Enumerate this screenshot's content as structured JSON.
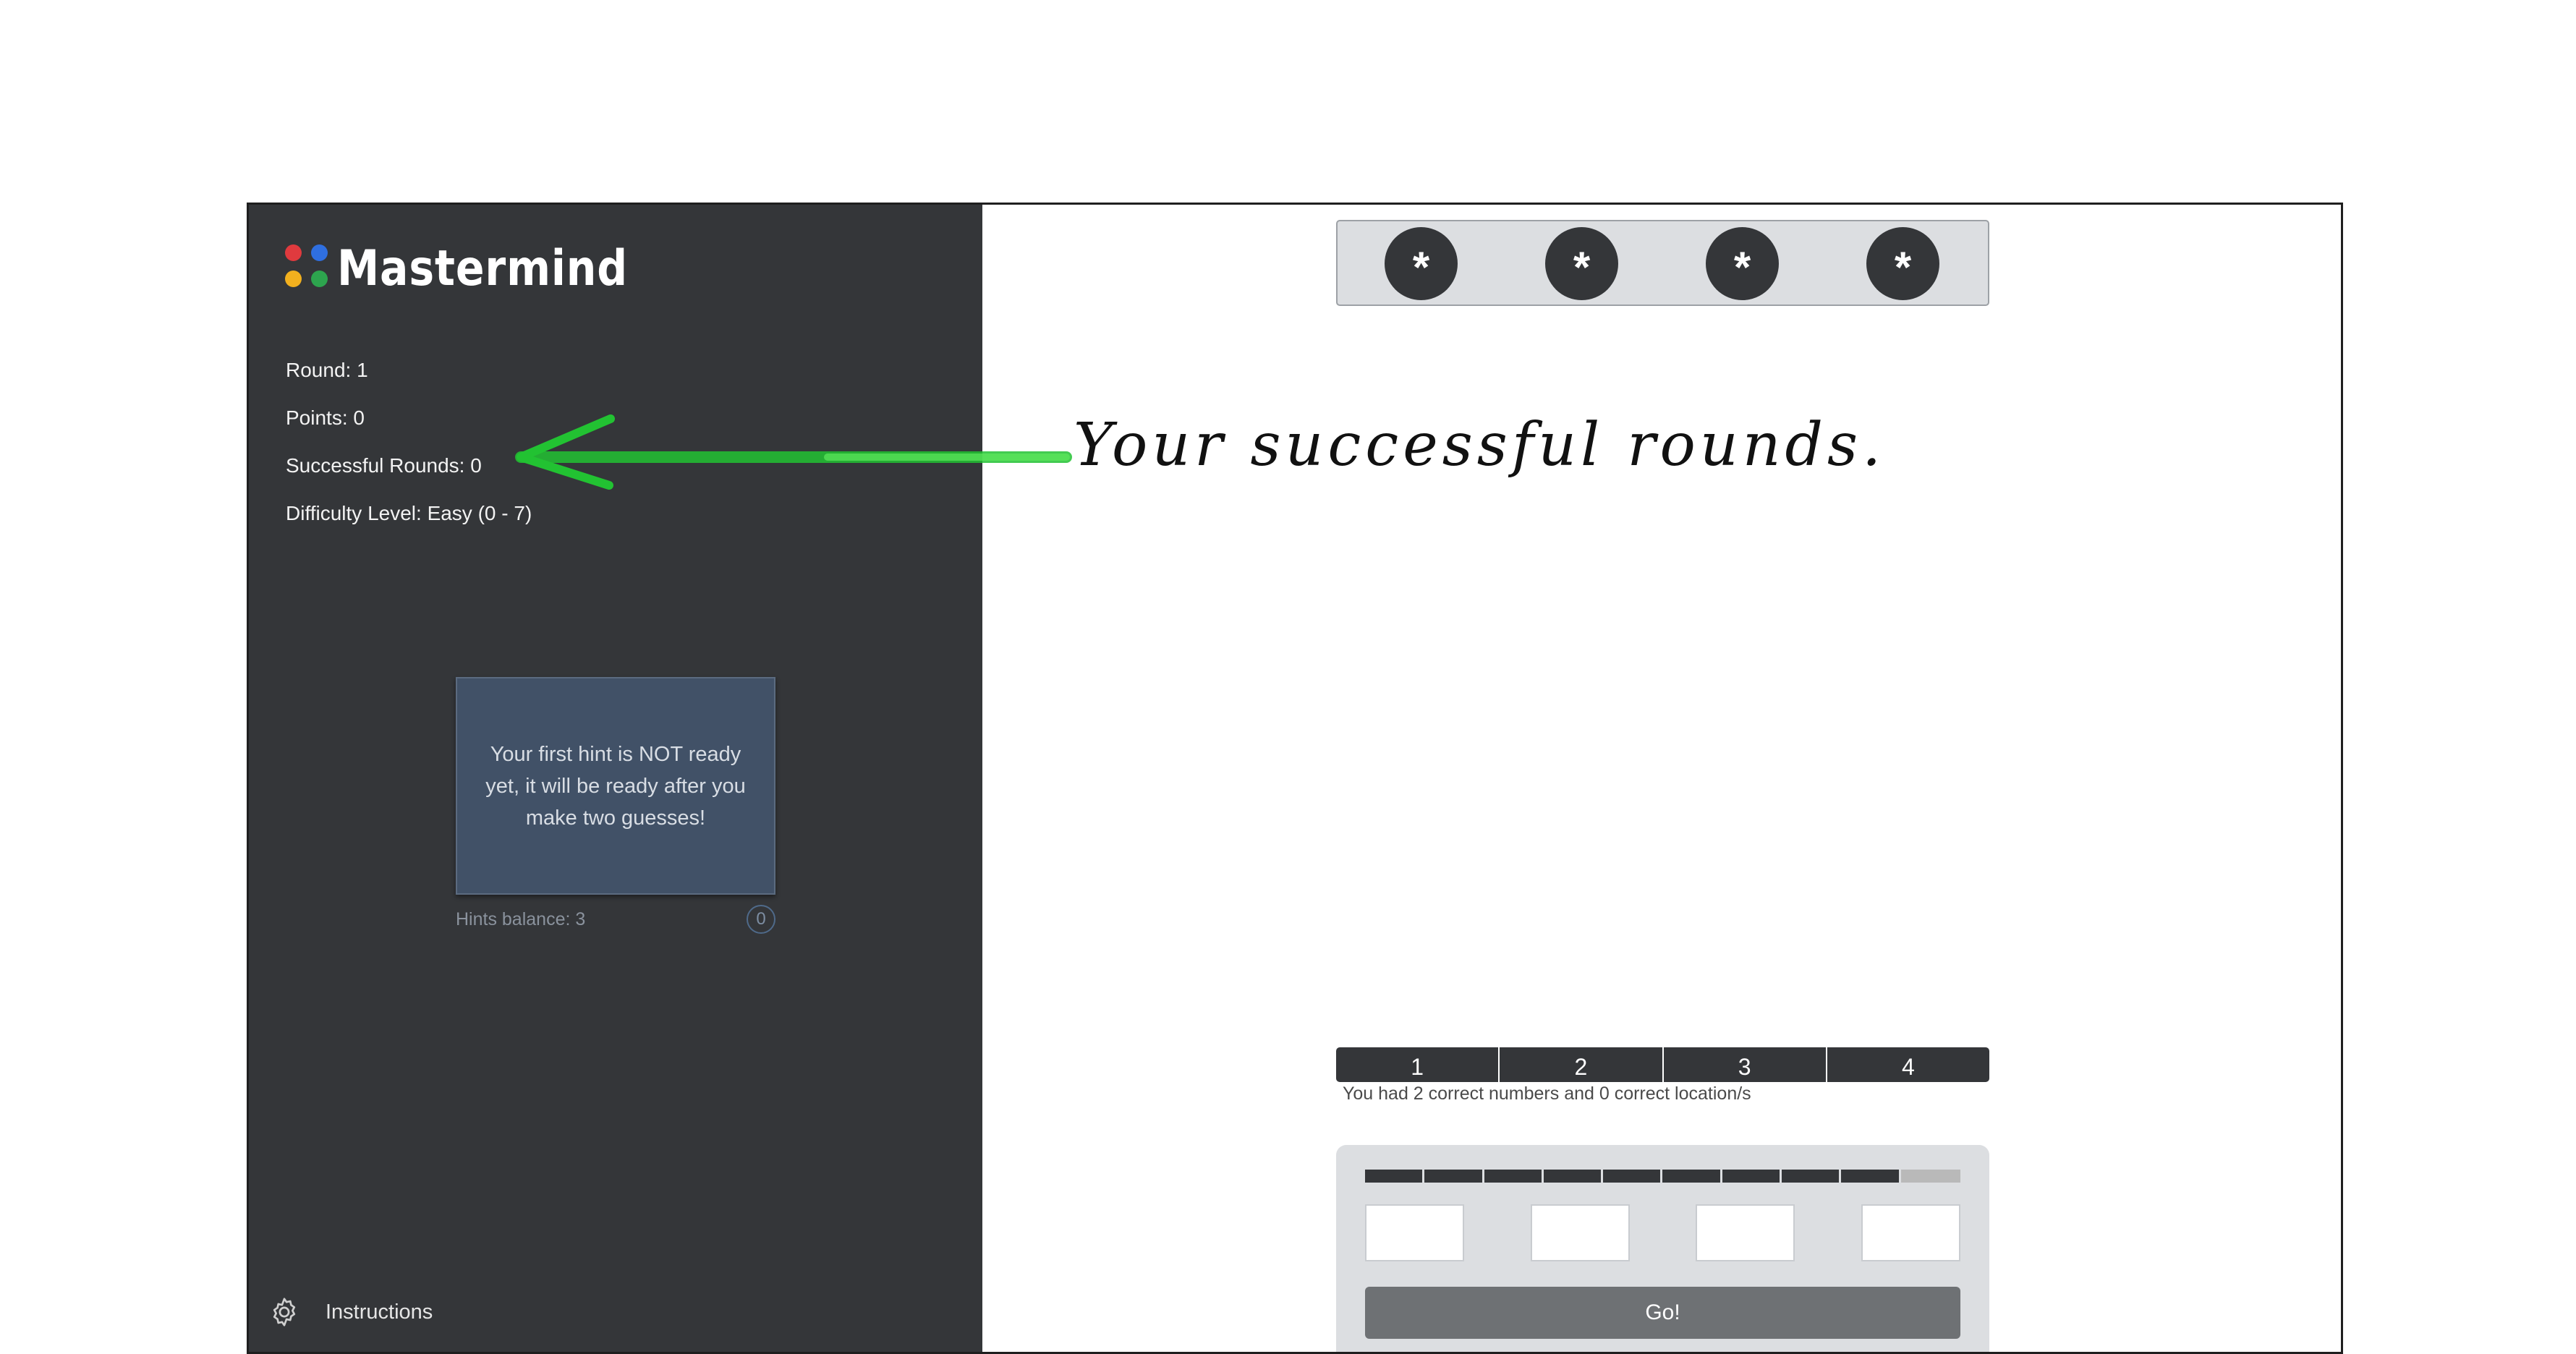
{
  "app": {
    "title": "Mastermind",
    "logo_colors": [
      "#e03a3e",
      "#2f6fe0",
      "#f2b01e",
      "#2da44e"
    ]
  },
  "sidebar": {
    "stats": [
      {
        "key": "round",
        "text": "Round: 1"
      },
      {
        "key": "points",
        "text": "Points: 0"
      },
      {
        "key": "successful_rounds",
        "text": "Successful Rounds: 0"
      },
      {
        "key": "difficulty",
        "text": "Difficulty Level: Easy (0 - 7)"
      }
    ],
    "hint_card": {
      "message": "Your first hint is NOT ready yet, it will be ready after you make two guesses!"
    },
    "hints_balance": "Hints balance: 3",
    "hints_used_count": "0",
    "instructions": {
      "label": "Instructions",
      "icon": "gear-icon"
    }
  },
  "secret": {
    "pegs": [
      "*",
      "*",
      "*",
      "*"
    ],
    "peg_color": "#343639"
  },
  "annotation": {
    "text": "Your successful rounds.",
    "arrow_color": "#22c232"
  },
  "guess_history": {
    "tabs": [
      "1",
      "2",
      "3",
      "4"
    ],
    "feedback": "You had 2 correct numbers and 0 correct location/s"
  },
  "input_panel": {
    "attempts": {
      "used": 9,
      "total": 10
    },
    "inputs": [
      {
        "value": "",
        "placeholder": ""
      },
      {
        "value": "",
        "placeholder": ""
      },
      {
        "value": "",
        "placeholder": ""
      },
      {
        "value": "",
        "placeholder": ""
      }
    ],
    "go_label": "Go!"
  },
  "colors": {
    "sidebar_bg": "#343639",
    "hint_card_bg": "#415167",
    "panel_bg": "#dcdee1",
    "go_button_bg": "#6e7174"
  }
}
